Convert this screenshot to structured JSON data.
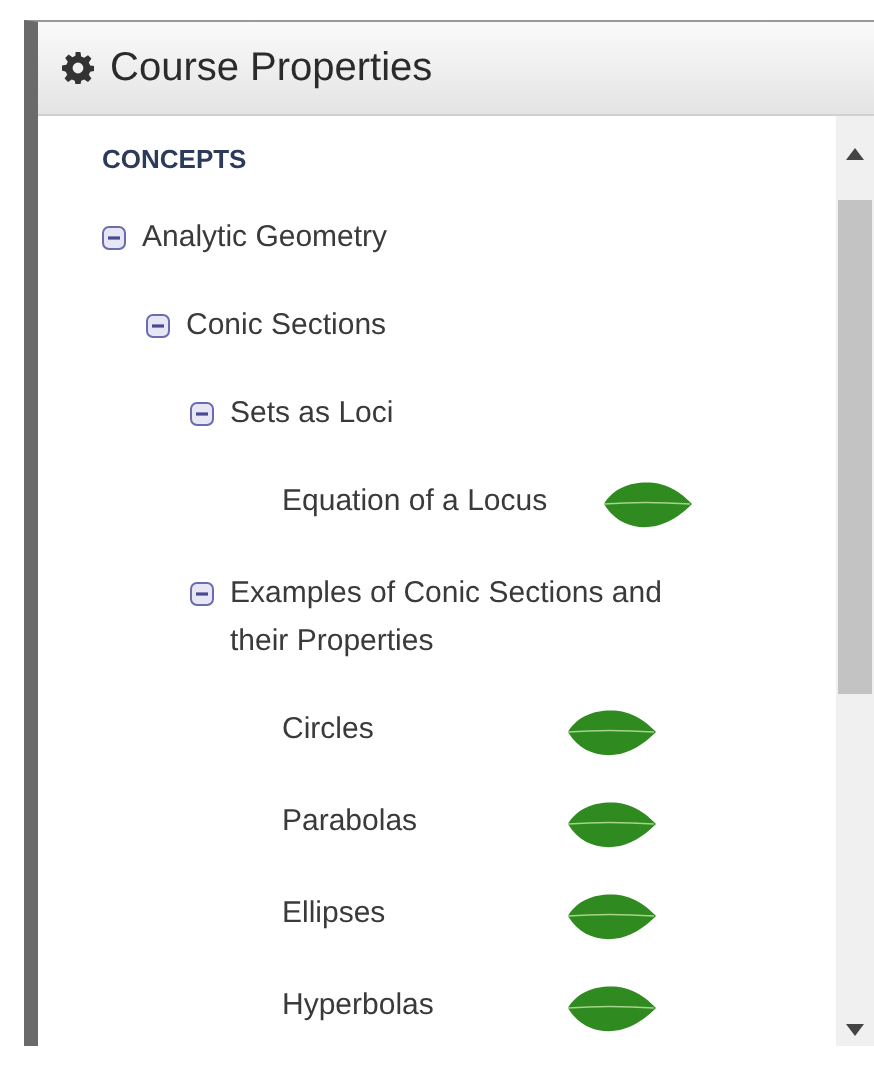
{
  "panel": {
    "title": "Course Properties"
  },
  "section": "CONCEPTS",
  "tree": [
    {
      "kind": "group",
      "label": "Analytic Geometry",
      "expanded": true,
      "children": [
        {
          "kind": "group",
          "label": "Conic Sections",
          "expanded": true,
          "children": [
            {
              "kind": "group",
              "label": "Sets as Loci",
              "expanded": true,
              "children": [
                {
                  "kind": "topic",
                  "label": "Equation of a Locus"
                }
              ]
            },
            {
              "kind": "group",
              "label": "Examples of Conic Sections and their Properties",
              "expanded": true,
              "children": [
                {
                  "kind": "topic",
                  "label": "Circles"
                },
                {
                  "kind": "topic",
                  "label": "Parabolas"
                },
                {
                  "kind": "topic",
                  "label": "Ellipses"
                },
                {
                  "kind": "topic",
                  "label": "Hyperbolas"
                }
              ]
            }
          ]
        }
      ]
    }
  ]
}
